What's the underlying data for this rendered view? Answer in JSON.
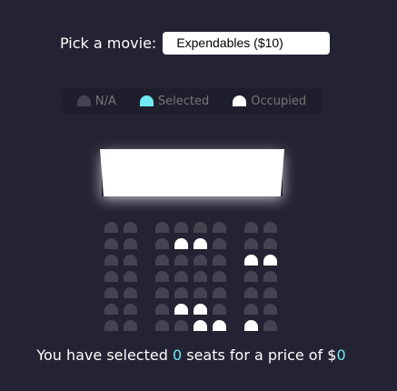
{
  "picker": {
    "label": "Pick a movie:",
    "selected": "Expendables ($10)"
  },
  "legend": [
    {
      "label": "N/A",
      "state": "na"
    },
    {
      "label": "Selected",
      "state": "selected"
    },
    {
      "label": "Occupied",
      "state": "occupied"
    }
  ],
  "seats": [
    [
      "na",
      "na",
      "na",
      "na",
      "na",
      "na",
      "na",
      "na"
    ],
    [
      "na",
      "na",
      "na",
      "occupied",
      "occupied",
      "na",
      "na",
      "na"
    ],
    [
      "na",
      "na",
      "na",
      "na",
      "na",
      "na",
      "occupied",
      "occupied"
    ],
    [
      "na",
      "na",
      "na",
      "na",
      "na",
      "na",
      "na",
      "na"
    ],
    [
      "na",
      "na",
      "na",
      "na",
      "na",
      "na",
      "na",
      "na"
    ],
    [
      "na",
      "na",
      "na",
      "occupied",
      "occupied",
      "na",
      "na",
      "na"
    ],
    [
      "na",
      "na",
      "na",
      "na",
      "occupied",
      "occupied",
      "occupied",
      "na"
    ]
  ],
  "info": {
    "prefix": "You have selected ",
    "count": "0",
    "middle": " seats for a price of $",
    "total": "0"
  },
  "colors": {
    "background": "#242333",
    "seat": "#444451",
    "selected": "#6feaf6",
    "occupied": "#ffffff"
  }
}
